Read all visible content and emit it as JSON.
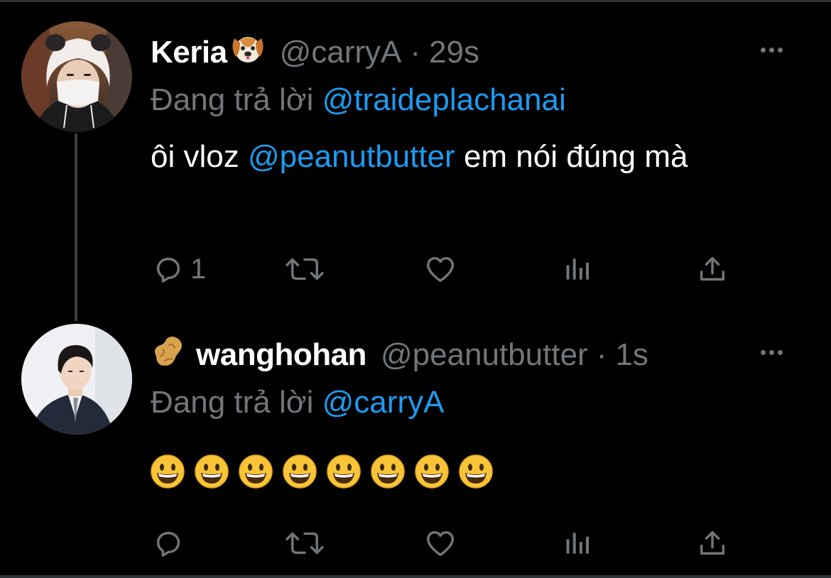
{
  "colors": {
    "background": "#000000",
    "text": "#ffffff",
    "muted": "#71767b",
    "link": "#1d9bf0"
  },
  "tweets": [
    {
      "display_name": "Keria",
      "name_emoji": "dog-face",
      "handle": "@carryA",
      "separator": "·",
      "time": "29s",
      "replying_label": "Đang trả lời",
      "replying_to": "@traideplachanai",
      "body_before": "ôi vloz ",
      "body_mention": "@peanutbutter",
      "body_after": " em nói đúng mà",
      "reply_count": "1",
      "icons": [
        "reply-icon",
        "retweet-icon",
        "like-icon",
        "views-icon",
        "share-icon"
      ]
    },
    {
      "display_name": "wanghohan",
      "name_emoji": "peanut",
      "handle": "@peanutbutter",
      "separator": "·",
      "time": "1s",
      "replying_label": "Đang trả lời",
      "replying_to": "@carryA",
      "body_emoji": "grinning-face",
      "body_emoji_count": 8,
      "reply_count": "",
      "icons": [
        "reply-icon",
        "retweet-icon",
        "like-icon",
        "views-icon",
        "share-icon"
      ]
    }
  ]
}
